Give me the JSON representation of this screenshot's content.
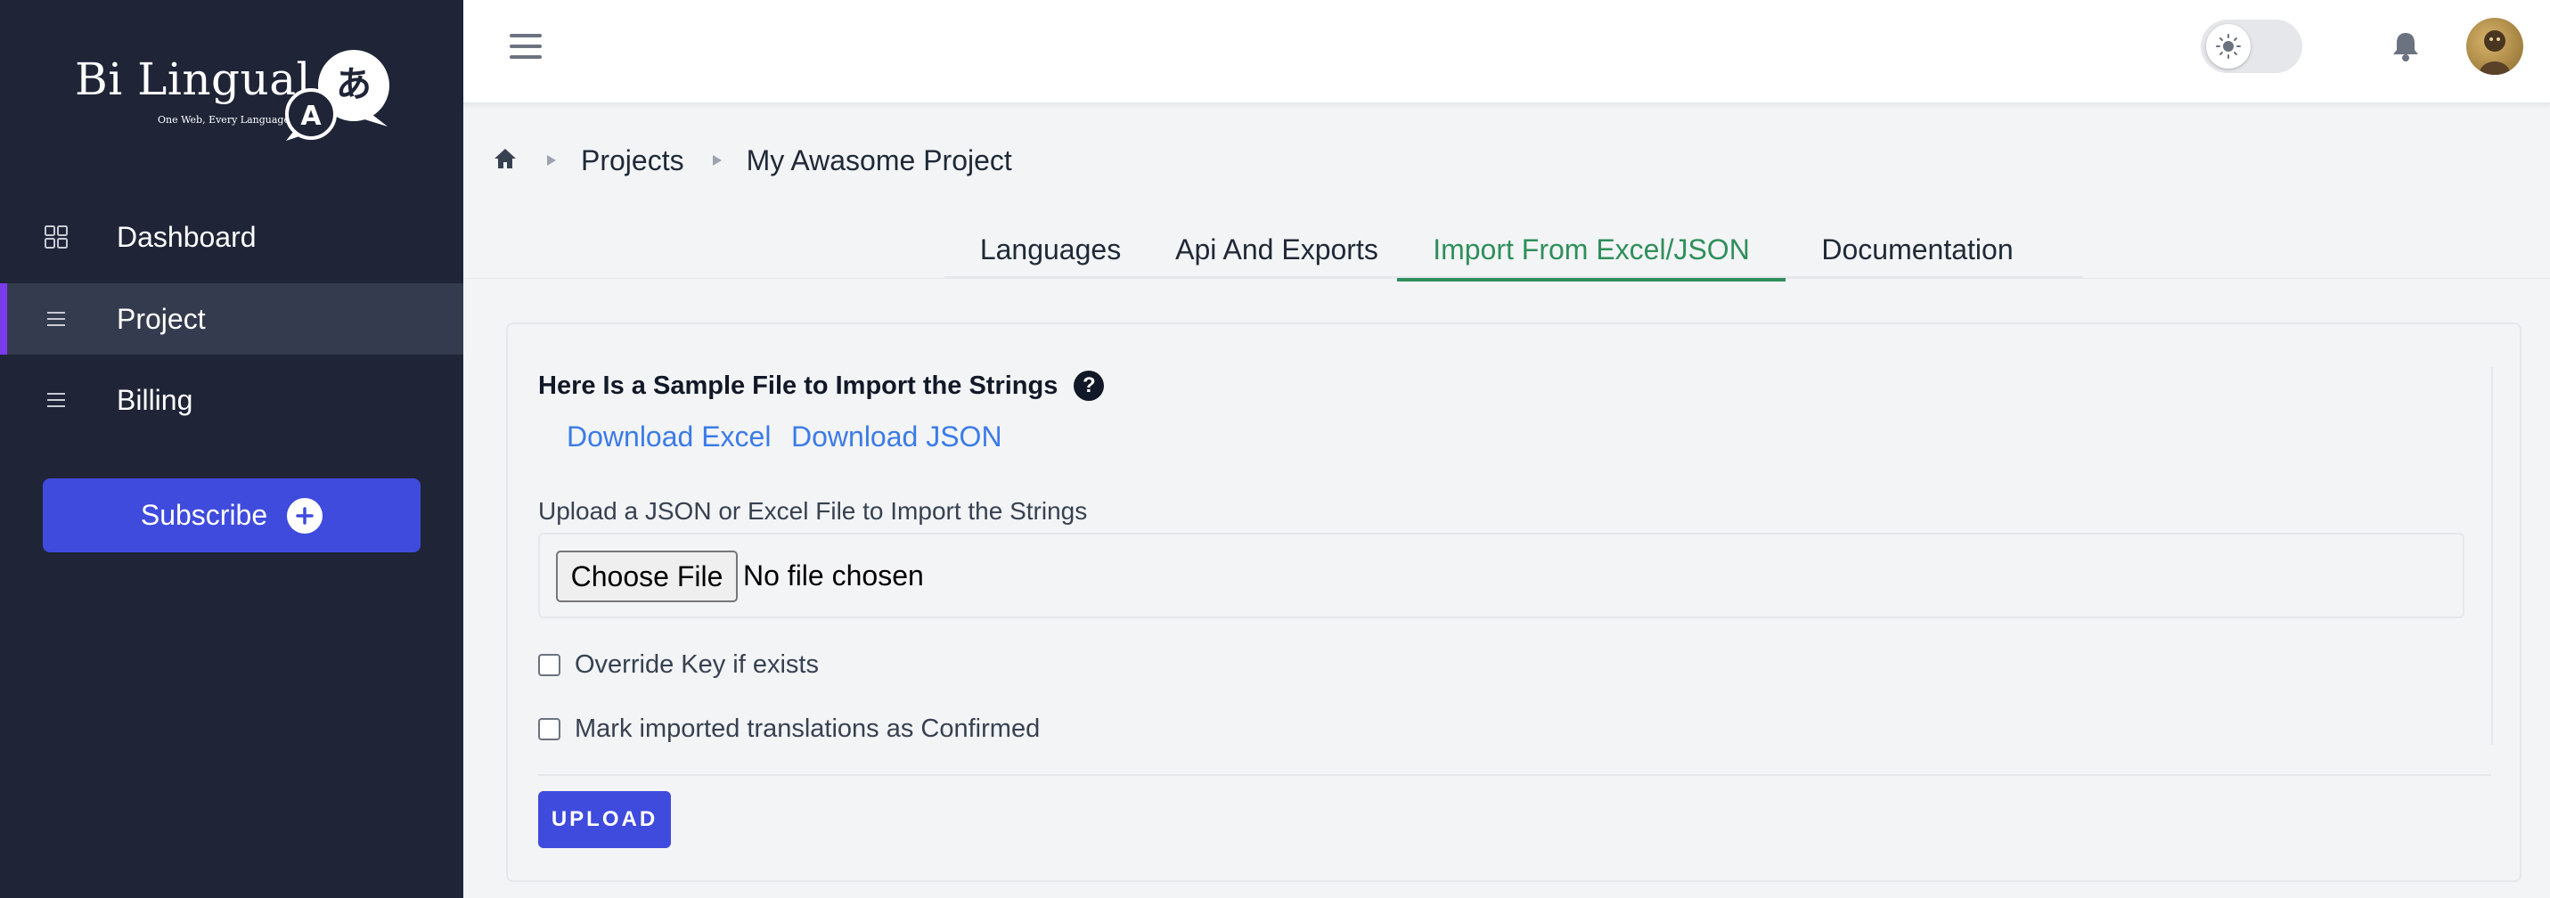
{
  "brand": {
    "name": "Bi Lingual",
    "tagline": "One Web, Every Language"
  },
  "sidebar": {
    "items": [
      {
        "label": "Dashboard",
        "icon": "grid-icon",
        "active": false
      },
      {
        "label": "Project",
        "icon": "list-icon",
        "active": true
      },
      {
        "label": "Billing",
        "icon": "list-icon",
        "active": false
      }
    ],
    "subscribe_label": "Subscribe"
  },
  "breadcrumb": {
    "items": [
      "Projects",
      "My Awasome Project"
    ]
  },
  "tabs": [
    {
      "label": "Languages",
      "active": false
    },
    {
      "label": "Api And Exports",
      "active": false
    },
    {
      "label": "Import From Excel/JSON",
      "active": true
    },
    {
      "label": "Documentation",
      "active": false
    }
  ],
  "import": {
    "sample_title": "Here Is a Sample File to Import the Strings",
    "help_glyph": "?",
    "download_excel": "Download Excel",
    "download_json": "Download JSON",
    "upload_label": "Upload a JSON or Excel File to Import the Strings",
    "choose_file": "Choose File",
    "no_file": "No file chosen",
    "override_label": "Override Key if exists",
    "confirm_label": "Mark imported translations as Confirmed",
    "upload_button": "UPLOAD"
  },
  "colors": {
    "sidebar_bg": "#1f2437",
    "accent": "#3f4bdc",
    "active_tab": "#2f8f5b",
    "link": "#3b7be8",
    "active_marker": "#7c3aed"
  }
}
